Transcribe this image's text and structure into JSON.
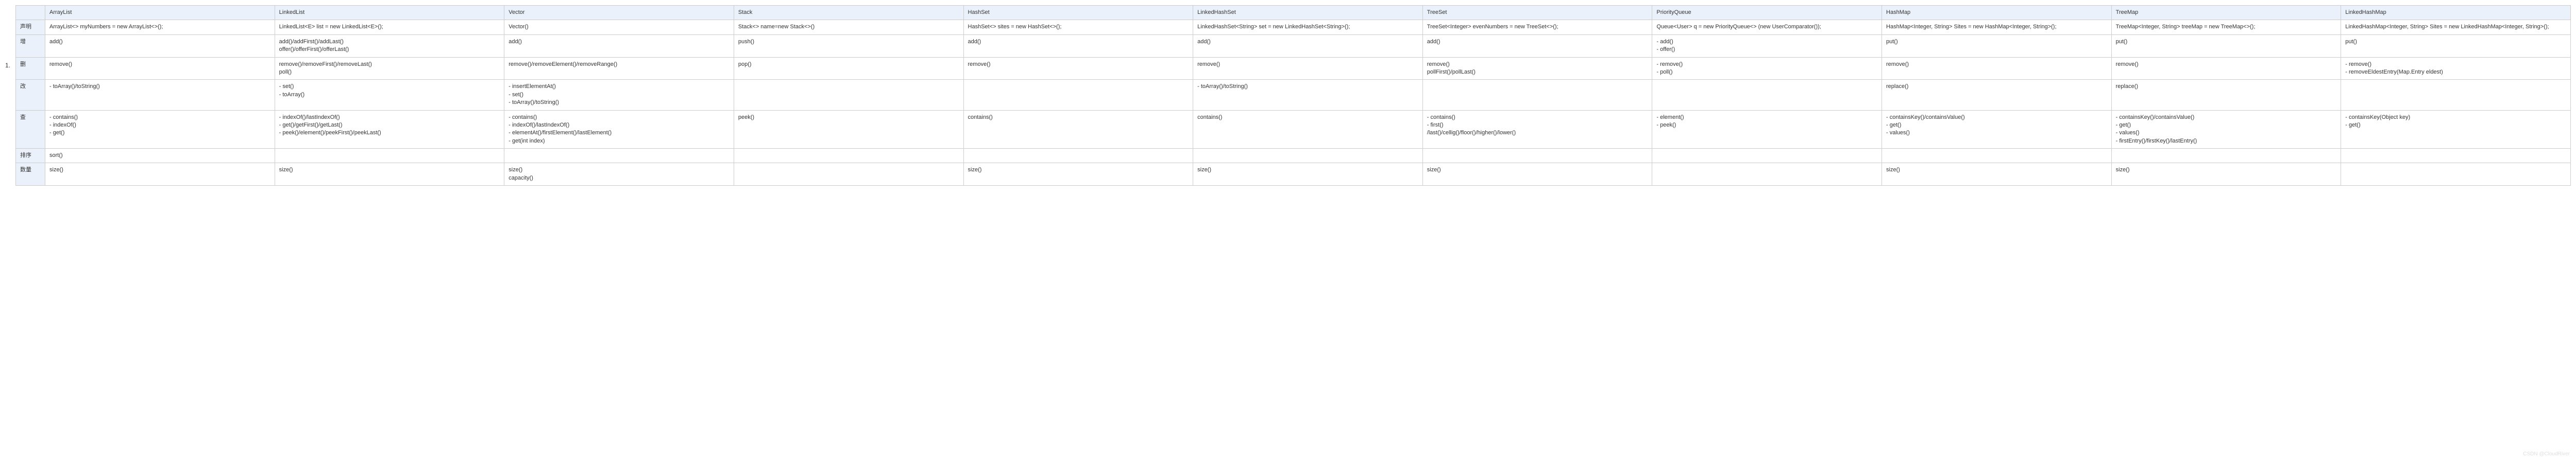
{
  "list_number": "1.",
  "watermark": "CSDN @CloudRiver",
  "headers": [
    "ArrayList",
    "LinkedList",
    "Vector",
    "Stack",
    "HashSet",
    "LinkedHashSet",
    "TreeSet",
    "PriorityQueue",
    "HashMap",
    "TreeMap",
    "LinkedHashMap"
  ],
  "rows": [
    {
      "label": "声明",
      "cells": [
        "ArrayList<> myNumbers = new ArrayList<>();",
        "LinkedList<E> list = new LinkedList<E>();",
        "Vector()",
        "Stack<> name=new Stack<>()",
        "HashSet<> sites = new HashSet<>();",
        "LinkedHashSet<String> set = new LinkedHashSet<String>();",
        "TreeSet<Integer> evenNumbers = new TreeSet<>();",
        "Queue<User> q = new PriorityQueue<> (new UserComparator());",
        "HashMap<Integer, String> Sites = new HashMap<Integer, String>();",
        "TreeMap<Integer, String> treeMap = new TreeMap<>();",
        "LinkedHashMap<Integer, String> Sites = new LinkedHashMap<Integer, String>();"
      ]
    },
    {
      "label": "增",
      "cells": [
        "add()",
        "add()/addFirst()/addLast()\noffer()/offerFirst()/offerLast()",
        "add()",
        "push()",
        "add()",
        "add()",
        "add()",
        "- add()\n- offer()",
        "put()",
        "put()",
        "put()"
      ]
    },
    {
      "label": "删",
      "cells": [
        "remove()",
        "remove()/removeFirst()/removeLast()\npoll()",
        "remove()/removeElement()/removeRange()",
        "pop()",
        "remove()",
        "remove()",
        "remove()\npollFirst()/pollLast()",
        "- remove()\n- poll()",
        "remove()",
        "remove()",
        "- remove()\n- removeEldestEntry(Map.Entry eldest)"
      ]
    },
    {
      "label": "改",
      "cells": [
        "- toArray()/toString()",
        "- set()\n- toArray()",
        "- insertElementAt()\n- set()\n- toArray()/toString()",
        "",
        "",
        "- toArray()/toString()",
        "",
        "",
        "replace()",
        "replace()",
        ""
      ]
    },
    {
      "label": "查",
      "cells": [
        "- contains()\n- indexOf()\n- get()",
        "- indexOf()/lastIndexOf()\n- get()/getFirst()/getLast()\n- peek()/element()/peekFirst()/peekLast()",
        "- contains()\n- indexOf()/lastIndexOf()\n- elementAt()/firstElement()/lastElement()\n- get(int index)",
        "peek()",
        "contains()",
        "contains()",
        "- contains()\n- first()\n/last()/cellig()/floor()/higher()/lower()",
        "- element()\n- peek()",
        "- containsKey()/containsValue()\n- get()\n- values()",
        "- containsKey()/containsValue()\n- get()\n- values()\n- firstEntry()/firstKey()/lastEntry()",
        "- containsKey(Object key)\n- get()"
      ]
    },
    {
      "label": "排序",
      "cells": [
        "sort()",
        "",
        "",
        "",
        "",
        "",
        "",
        "",
        "",
        "",
        ""
      ]
    },
    {
      "label": "数量",
      "cells": [
        "size()",
        "size()",
        "size()\ncapacity()",
        "",
        "size()",
        "size()",
        "size()",
        "",
        "size()",
        "size()",
        ""
      ]
    }
  ]
}
